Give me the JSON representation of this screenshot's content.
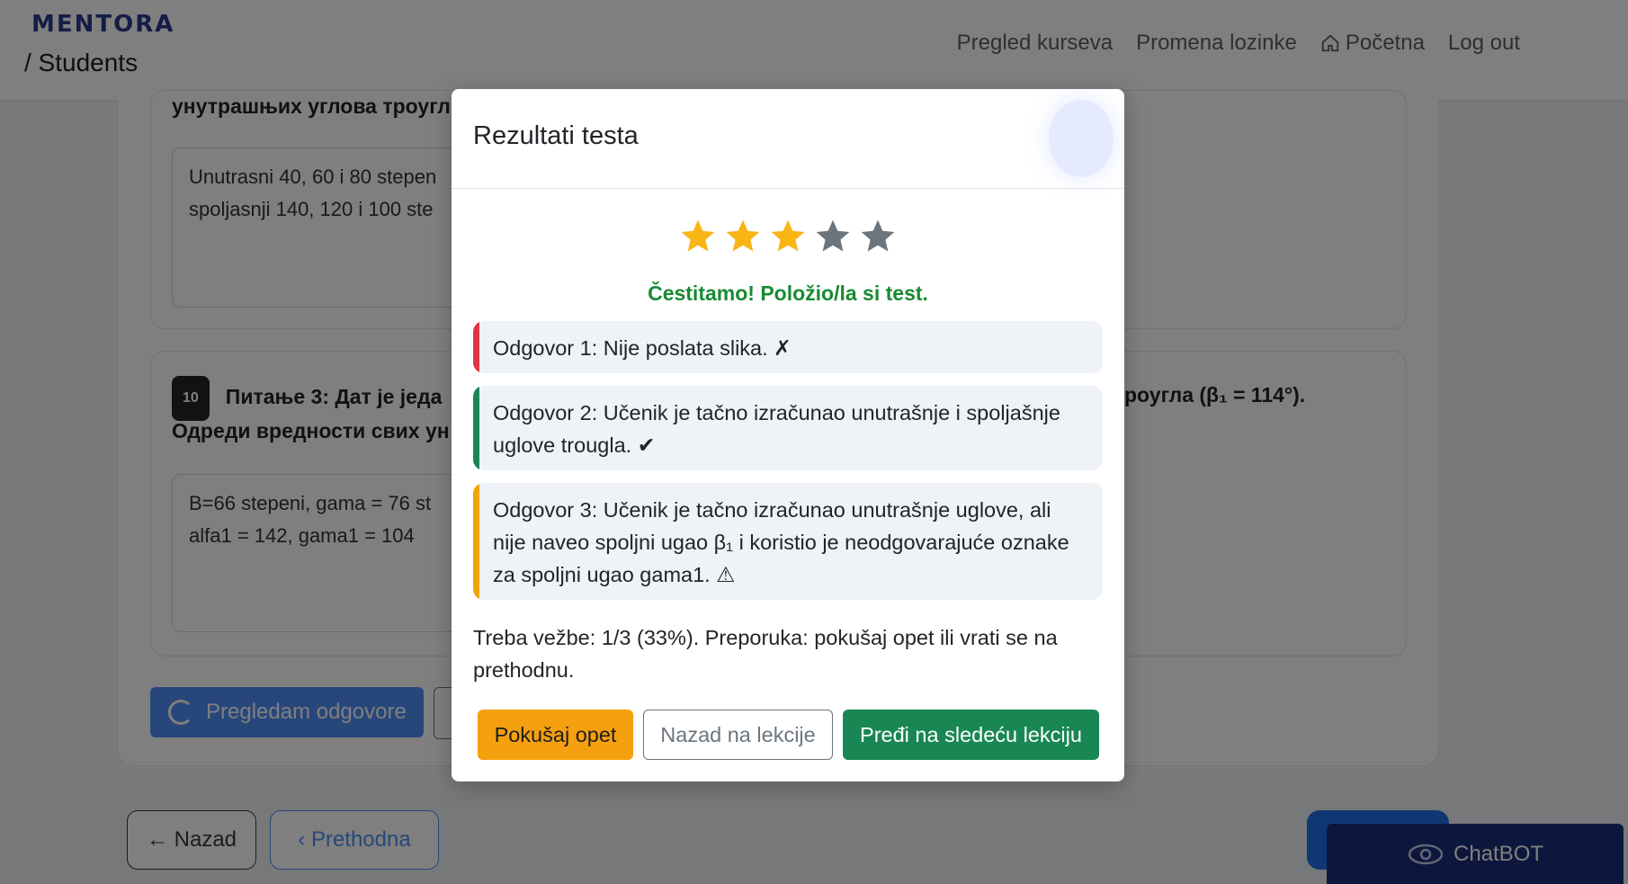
{
  "navbar": {
    "brand": "MENTORA",
    "section": "/ Students",
    "links": [
      "Pregled kurseva",
      "Promena lozinke",
      "Početna",
      "Log out"
    ]
  },
  "background": {
    "q2_text": "унутрашњих углова троугл",
    "q2_answer": "Unutrasni 40, 60 i 80 stepen\nspoljasnji 140, 120 i 100 ste",
    "q3_points": "10",
    "q3_line1_left": "Питање 3: Дат је једа",
    "q3_line1_right": "роугла (β₁ = 114°).",
    "q3_line2": "Одреди вредности свих ун",
    "q3_answer": "B=66 stepeni, gama = 76 st\nalfa1 = 142, gama1 = 104",
    "review_button": "Pregledam odgovore"
  },
  "footer": {
    "back": "← Nazad",
    "prev": "‹ Prethodna",
    "chatbot": "ChatBOT"
  },
  "modal": {
    "title": "Rezultati testa",
    "rating": 3,
    "max_rating": 5,
    "star_on_color": "#f9b416",
    "star_off_color": "#6c757d",
    "congrats": "Čestitamo! Položio/la si test.",
    "feedback": [
      {
        "text": "Odgovor 1: Nije poslata slika. ✗",
        "status": "wrong"
      },
      {
        "text": "Odgovor 2: Učenik je tačno izračunao unutrašnje i spoljašnje uglove trougla. ✔",
        "status": "correct"
      },
      {
        "text": "Odgovor 3: Učenik je tačno izračunao unutrašnje uglove, ali nije naveo spoljni ugao β₁ i koristio je neodgovarajuće oznake za spoljni ugao gama1. ⚠",
        "status": "partial"
      }
    ],
    "summary": "Treba vežbe: 1/3 (33%). Preporuka: pokušaj opet ili vrati se na prethodnu.",
    "buttons": {
      "retry": "Pokušaj opet",
      "back_to_lessons": "Nazad na lekcije",
      "next_lesson": "Pređi na sledeću lekciju"
    }
  }
}
